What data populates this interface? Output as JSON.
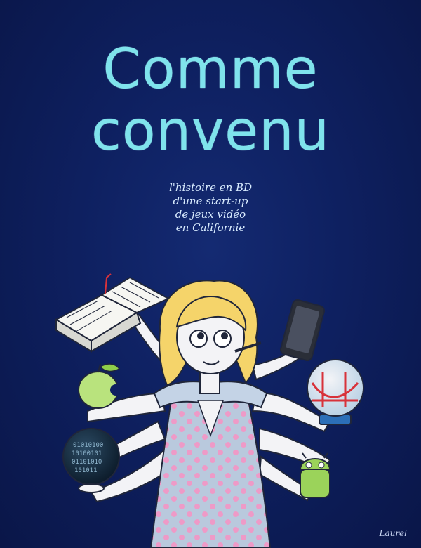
{
  "cover": {
    "title_line1": "Comme",
    "title_line2": "convenu",
    "subtitle_lines": [
      "l'histoire en BD",
      "d'une start-up",
      "de jeux vidéo",
      "en Californie"
    ],
    "signature": "Laurel"
  },
  "colors": {
    "background": "#0b1a4d",
    "title": "#7fe3ec",
    "hair": "#f5d46a",
    "dress": "#b9c9dd",
    "dots": "#ee9ac7",
    "android": "#9bd35a",
    "bridge": "#d8323a"
  },
  "icons": [
    "comic-book-icon",
    "smartphone-icon",
    "apple-icon",
    "snow-globe-bridge-icon",
    "binary-globe-icon",
    "android-figurine-icon"
  ]
}
